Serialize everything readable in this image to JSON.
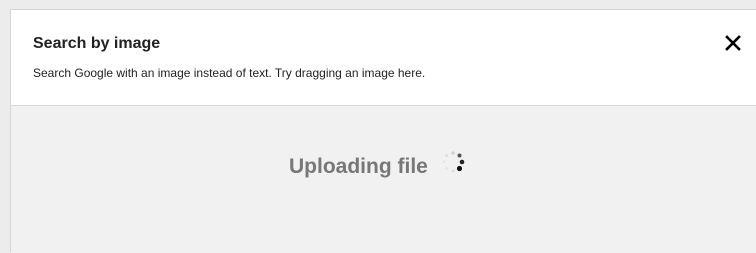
{
  "dialog": {
    "title": "Search by image",
    "subtitle": "Search Google with an image instead of text. Try dragging an image here.",
    "close_icon": "close-icon"
  },
  "upload": {
    "status_text": "Uploading file",
    "spinner_icon": "loading-spinner-icon"
  },
  "colors": {
    "header_bg": "#ffffff",
    "body_bg": "#f1f1f1",
    "title_text": "#222222",
    "status_text": "#777777"
  }
}
